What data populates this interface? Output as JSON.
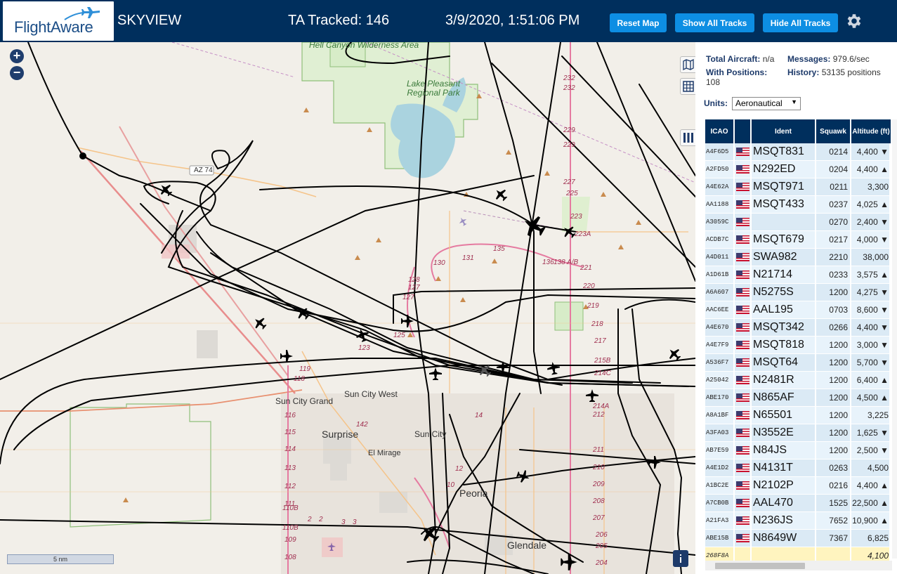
{
  "header": {
    "logo_text": "FlightAware",
    "app_name": "SKYVIEW",
    "tracked": "TA Tracked: 146",
    "datetime": "3/9/2020, 1:51:06 PM",
    "buttons": {
      "reset": "Reset Map",
      "show_all": "Show All Tracks",
      "hide_all": "Hide All Tracks"
    },
    "colors": {
      "header_bg": "#002f5d",
      "button_bg": "#0d8ee3"
    }
  },
  "map": {
    "zoom_in": "+",
    "zoom_out": "−",
    "scale": "5 nm",
    "labels": {
      "wilderness": "Hell Canyon Wilderness Area",
      "lake": "Lake Pleasant Regional Park",
      "az74": "AZ 74",
      "sun_city_grand": "Sun City Grand",
      "sun_city_west": "Sun City West",
      "surprise": "Surprise",
      "sun_city": "Sun City",
      "el_mirage": "El Mirage",
      "peoria": "Peoria",
      "glendale": "Glendale"
    },
    "route_numbers": [
      "232",
      "232",
      "229",
      "229",
      "227",
      "225",
      "223",
      "223A",
      "221",
      "220",
      "219",
      "218",
      "217",
      "215B",
      "214C",
      "214A",
      "212",
      "211",
      "210",
      "209",
      "208",
      "207",
      "206",
      "205",
      "204",
      "135",
      "138 A/B",
      "136",
      "131",
      "130",
      "128",
      "127",
      "127",
      "125",
      "123",
      "119",
      "118",
      "116",
      "115",
      "114",
      "113",
      "112",
      "111",
      "110B",
      "110B",
      "109",
      "108",
      "142",
      "14",
      "12",
      "10",
      "2",
      "3",
      "3",
      "2"
    ],
    "aircraft_count_shown": 24
  },
  "sidebar": {
    "total_aircraft_label": "Total Aircraft:",
    "total_aircraft_value": "n/a",
    "messages_label": "Messages:",
    "messages_value": "979.6/sec",
    "with_positions_label": "With Positions:",
    "with_positions_value": "108",
    "history_label": "History:",
    "history_value": "53135 positions",
    "units_label": "Units:",
    "units_value": "Aeronautical",
    "columns": [
      "ICAO",
      "",
      "Ident",
      "Squawk",
      "Altitude (ft)"
    ],
    "rows": [
      {
        "icao": "A4F6D5",
        "ident": "MSQT831",
        "squawk": "0214",
        "alt": "4,400 ▼"
      },
      {
        "icao": "A2FD50",
        "ident": "N292ED",
        "squawk": "0204",
        "alt": "4,400 ▲"
      },
      {
        "icao": "A4E62A",
        "ident": "MSQT971",
        "squawk": "0211",
        "alt": "3,300"
      },
      {
        "icao": "AA1188",
        "ident": "MSQT433",
        "squawk": "0237",
        "alt": "4,025 ▲"
      },
      {
        "icao": "A3059C",
        "ident": "",
        "squawk": "0270",
        "alt": "2,400 ▼"
      },
      {
        "icao": "ACDB7C",
        "ident": "MSQT679",
        "squawk": "0217",
        "alt": "4,000 ▼"
      },
      {
        "icao": "A4D011",
        "ident": "SWA982",
        "squawk": "2210",
        "alt": "38,000"
      },
      {
        "icao": "A1D61B",
        "ident": "N21714",
        "squawk": "0233",
        "alt": "3,575 ▲"
      },
      {
        "icao": "A6A607",
        "ident": "N5275S",
        "squawk": "1200",
        "alt": "4,275 ▼"
      },
      {
        "icao": "AAC6EE",
        "ident": "AAL195",
        "squawk": "0703",
        "alt": "8,600 ▼"
      },
      {
        "icao": "A4E670",
        "ident": "MSQT342",
        "squawk": "0266",
        "alt": "4,400 ▼"
      },
      {
        "icao": "A4E7F9",
        "ident": "MSQT818",
        "squawk": "1200",
        "alt": "3,000 ▼"
      },
      {
        "icao": "A536F7",
        "ident": "MSQT64",
        "squawk": "1200",
        "alt": "5,700 ▼"
      },
      {
        "icao": "A25042",
        "ident": "N2481R",
        "squawk": "1200",
        "alt": "6,400 ▲"
      },
      {
        "icao": "ABE170",
        "ident": "N865AF",
        "squawk": "1200",
        "alt": "4,500 ▲"
      },
      {
        "icao": "A8A1BF",
        "ident": "N65501",
        "squawk": "1200",
        "alt": "3,225"
      },
      {
        "icao": "A3FA03",
        "ident": "N3552E",
        "squawk": "1200",
        "alt": "1,625 ▼"
      },
      {
        "icao": "AB7E59",
        "ident": "N84JS",
        "squawk": "1200",
        "alt": "2,500 ▼"
      },
      {
        "icao": "A4E1D2",
        "ident": "N4131T",
        "squawk": "0263",
        "alt": "4,500"
      },
      {
        "icao": "A1BC2E",
        "ident": "N2102P",
        "squawk": "0216",
        "alt": "4,400 ▲"
      },
      {
        "icao": "A7CB0B",
        "ident": "AAL470",
        "squawk": "1525",
        "alt": "22,500 ▲"
      },
      {
        "icao": "A21FA3",
        "ident": "N236JS",
        "squawk": "7652",
        "alt": "10,900 ▲"
      },
      {
        "icao": "ABE15B",
        "ident": "N8649W",
        "squawk": "7367",
        "alt": "6,825"
      },
      {
        "icao": "268F8A",
        "ident": "",
        "squawk": "",
        "alt": "4,100",
        "highlight": true
      }
    ]
  }
}
